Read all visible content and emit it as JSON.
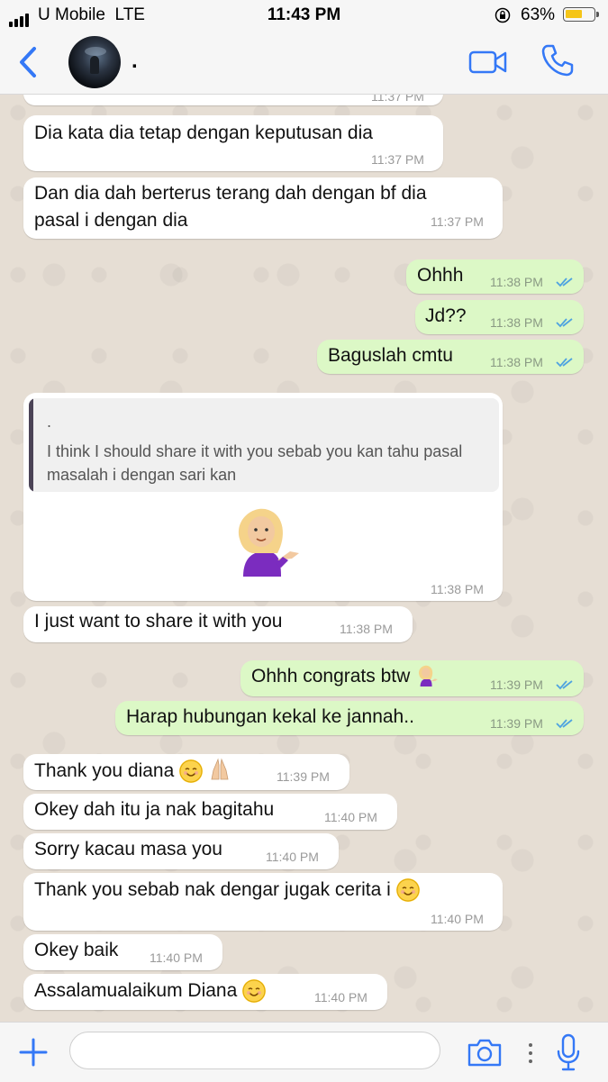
{
  "status_bar": {
    "carrier": "U Mobile",
    "network": "LTE",
    "time": "11:43 PM",
    "battery_percent": "63%",
    "battery_level": 0.63,
    "battery_color": "#f5c518"
  },
  "header": {
    "contact_name": ".",
    "back_icon": "chevron-left-icon",
    "video_icon": "video-camera-icon",
    "call_icon": "phone-icon",
    "accent_color": "#3478f6"
  },
  "messages": [
    {
      "id": "m0",
      "dir": "in",
      "text": "",
      "time": "11:37 PM"
    },
    {
      "id": "m1",
      "dir": "in",
      "text": "Dia kata dia tetap dengan keputusan dia",
      "time": "11:37 PM"
    },
    {
      "id": "m2",
      "dir": "in",
      "lines": [
        "Dan dia dah berterus terang dah dengan bf dia",
        "pasal i dengan dia"
      ],
      "time": "11:37 PM"
    },
    {
      "id": "m3",
      "dir": "out",
      "text": "Ohhh",
      "time": "11:38 PM",
      "status": "read"
    },
    {
      "id": "m4",
      "dir": "out",
      "text": "Jd??",
      "time": "11:38 PM",
      "status": "read"
    },
    {
      "id": "m5",
      "dir": "out",
      "text": "Baguslah cmtu",
      "time": "11:38 PM",
      "status": "read"
    },
    {
      "id": "m6",
      "dir": "in",
      "type": "reply",
      "quote_author": ".",
      "quote_text": "I think I should share it with you sebab you kan tahu pasal masalah i dengan sari kan",
      "emoji": "woman-tipping-hand",
      "time": "11:38 PM"
    },
    {
      "id": "m7",
      "dir": "in",
      "text": "I just want to share it with you",
      "time": "11:38 PM"
    },
    {
      "id": "m8",
      "dir": "out",
      "text": "Ohhh congrats btw",
      "emoji": "woman-tipping-hand",
      "time": "11:39 PM",
      "status": "read"
    },
    {
      "id": "m9",
      "dir": "out",
      "text": "Harap hubungan kekal ke jannah..",
      "time": "11:39 PM",
      "status": "read"
    },
    {
      "id": "m10",
      "dir": "in",
      "text": "Thank you diana",
      "emoji": "smiling-face folded-hands",
      "time": "11:39 PM"
    },
    {
      "id": "m11",
      "dir": "in",
      "text": "Okey dah itu ja nak bagitahu",
      "time": "11:40 PM"
    },
    {
      "id": "m12",
      "dir": "in",
      "text": "Sorry kacau masa you",
      "time": "11:40 PM"
    },
    {
      "id": "m13",
      "dir": "in",
      "text": "Thank you sebab nak dengar jugak cerita i",
      "emoji": "smiling-face",
      "time": "11:40 PM"
    },
    {
      "id": "m14",
      "dir": "in",
      "text": "Okey baik",
      "time": "11:40 PM"
    },
    {
      "id": "m15",
      "dir": "in",
      "text": "Assalamualaikum Diana",
      "emoji": "smiling-face",
      "time": "11:40 PM"
    }
  ],
  "input_bar": {
    "placeholder": "",
    "value": "",
    "plus_icon": "plus-icon",
    "camera_icon": "camera-icon",
    "mic_icon": "microphone-icon"
  },
  "colors": {
    "incoming_bubble": "#ffffff",
    "outgoing_bubble": "#dcf8c6",
    "read_tick": "#4fa3e0",
    "chat_background": "#e6ded4"
  }
}
